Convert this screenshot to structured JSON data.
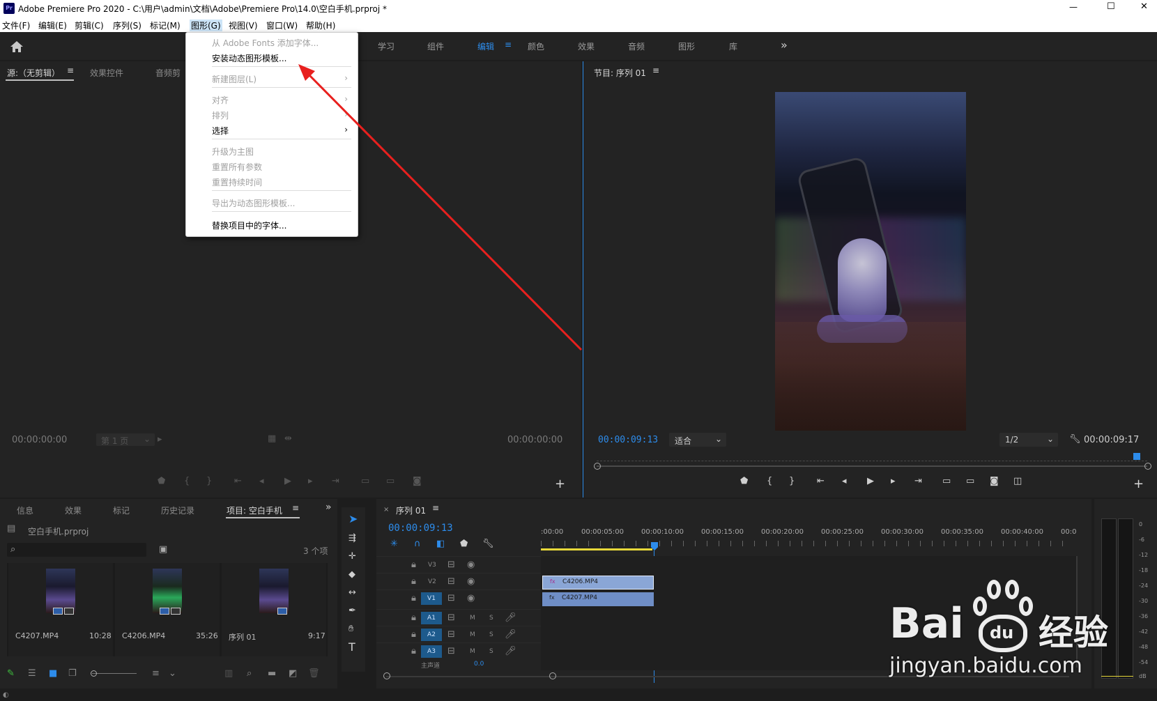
{
  "app": {
    "title": "Adobe Premiere Pro 2020 - C:\\用户\\admin\\文档\\Adobe\\Premiere Pro\\14.0\\空白手机.prproj *",
    "icon": "Pr"
  },
  "window_controls": {
    "minimize": "—",
    "maximize": "☐",
    "close": "✕"
  },
  "menubar": [
    "文件(F)",
    "编辑(E)",
    "剪辑(C)",
    "序列(S)",
    "标记(M)",
    "图形(G)",
    "视图(V)",
    "窗口(W)",
    "帮助(H)"
  ],
  "workspaces": [
    "学习",
    "组件",
    "编辑",
    "颜色",
    "效果",
    "音频",
    "图形",
    "库"
  ],
  "workspace_more": "»",
  "graphics_menu": {
    "items": [
      {
        "label": "从 Adobe Fonts 添加字体...",
        "disabled": true
      },
      {
        "label": "安装动态图形模板...",
        "disabled": false
      },
      {
        "label": "新建图层(L)",
        "disabled": true,
        "submenu": true
      },
      {
        "label": "对齐",
        "disabled": true,
        "submenu": true
      },
      {
        "label": "排列",
        "disabled": true,
        "submenu": true
      },
      {
        "label": "选择",
        "disabled": false,
        "submenu": true
      },
      {
        "label": "升级为主图",
        "disabled": true
      },
      {
        "label": "重置所有参数",
        "disabled": true
      },
      {
        "label": "重置持续时间",
        "disabled": true
      },
      {
        "label": "导出为动态图形模板...",
        "disabled": true
      },
      {
        "label": "替换项目中的字体...",
        "disabled": false
      }
    ]
  },
  "source_panel": {
    "tabs": [
      "源:（无剪辑）",
      "效果控件",
      "音频剪"
    ],
    "tc_left": "00:00:00:00",
    "page": "第 1 页",
    "tc_right": "00:00:00:00"
  },
  "program_panel": {
    "title": "节目: 序列 01",
    "tc_left": "00:00:09:13",
    "fit": "适合",
    "res": "1/2",
    "tc_right": "00:00:09:17"
  },
  "project_panel": {
    "tabs": [
      "信息",
      "效果",
      "标记",
      "历史记录",
      "项目: 空白手机"
    ],
    "file": "空白手机.prproj",
    "count": "3 个项",
    "items": [
      {
        "name": "C4207.MP4",
        "dur": "10:28"
      },
      {
        "name": "C4206.MP4",
        "dur": "35:26"
      },
      {
        "name": "序列 01",
        "dur": "9:17"
      }
    ]
  },
  "timeline": {
    "title": "序列 01",
    "tc": "00:00:09:13",
    "ruler": [
      ":00:00",
      "00:00:05:00",
      "00:00:10:00",
      "00:00:15:00",
      "00:00:20:00",
      "00:00:25:00",
      "00:00:30:00",
      "00:00:35:00",
      "00:00:40:00",
      "00:0"
    ],
    "video_tracks": [
      "V3",
      "V2",
      "V1"
    ],
    "audio_tracks": [
      "A1",
      "A2",
      "A3"
    ],
    "clips": [
      {
        "name": "C4206.MP4",
        "track": "V2"
      },
      {
        "name": "C4207.MP4",
        "track": "V1"
      }
    ],
    "master": "主声道",
    "master_val": "0.0",
    "track_buttons": {
      "mute": "M",
      "solo": "S"
    }
  },
  "meter": {
    "labels": [
      "0",
      "-6",
      "-12",
      "-18",
      "-24",
      "-30",
      "-36",
      "-42",
      "-48",
      "-54",
      "dB"
    ]
  },
  "watermark": {
    "brand": "Bai",
    "paw": "du",
    "cn": "经验",
    "url": "jingyan.baidu.com"
  }
}
